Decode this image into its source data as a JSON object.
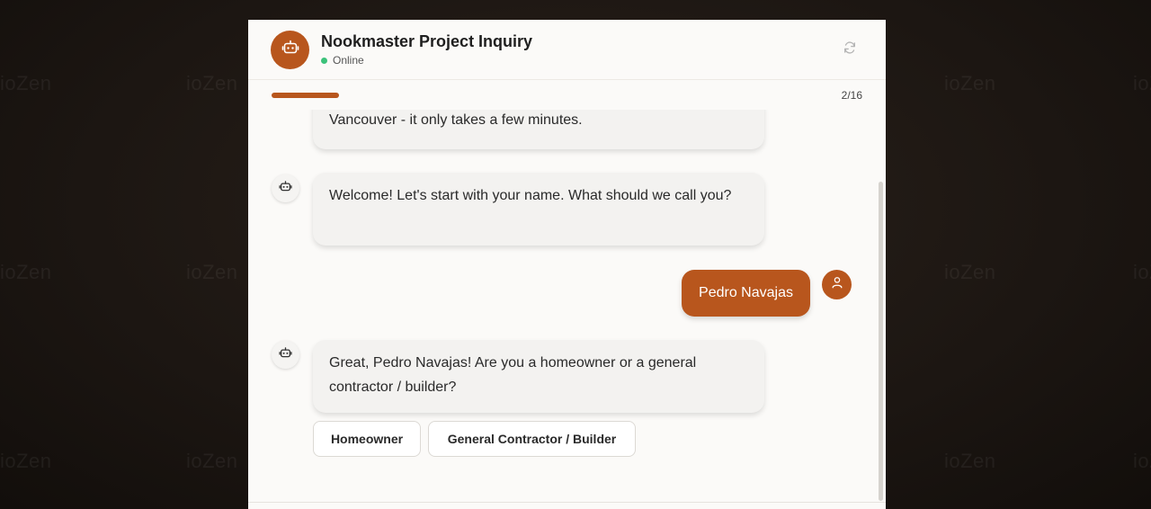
{
  "background": {
    "watermark": "ioZen"
  },
  "header": {
    "title": "Nookmaster Project Inquiry",
    "status": "Online",
    "status_color": "#3cc27a",
    "bot_icon": "robot-icon",
    "refresh_icon": "refresh-icon"
  },
  "progress": {
    "count": "2/16",
    "fraction": 0.125,
    "accent": "#b8561d"
  },
  "messages": {
    "m1": "Vancouver - it only takes a few minutes.",
    "m2": "Welcome! Let's start with your name. What should we call you?",
    "m3": "Pedro Navajas",
    "m4": "Great, Pedro Navajas! Are you a homeowner or a general contractor / builder?"
  },
  "options": {
    "o1": "Homeowner",
    "o2": "General Contractor / Builder"
  }
}
